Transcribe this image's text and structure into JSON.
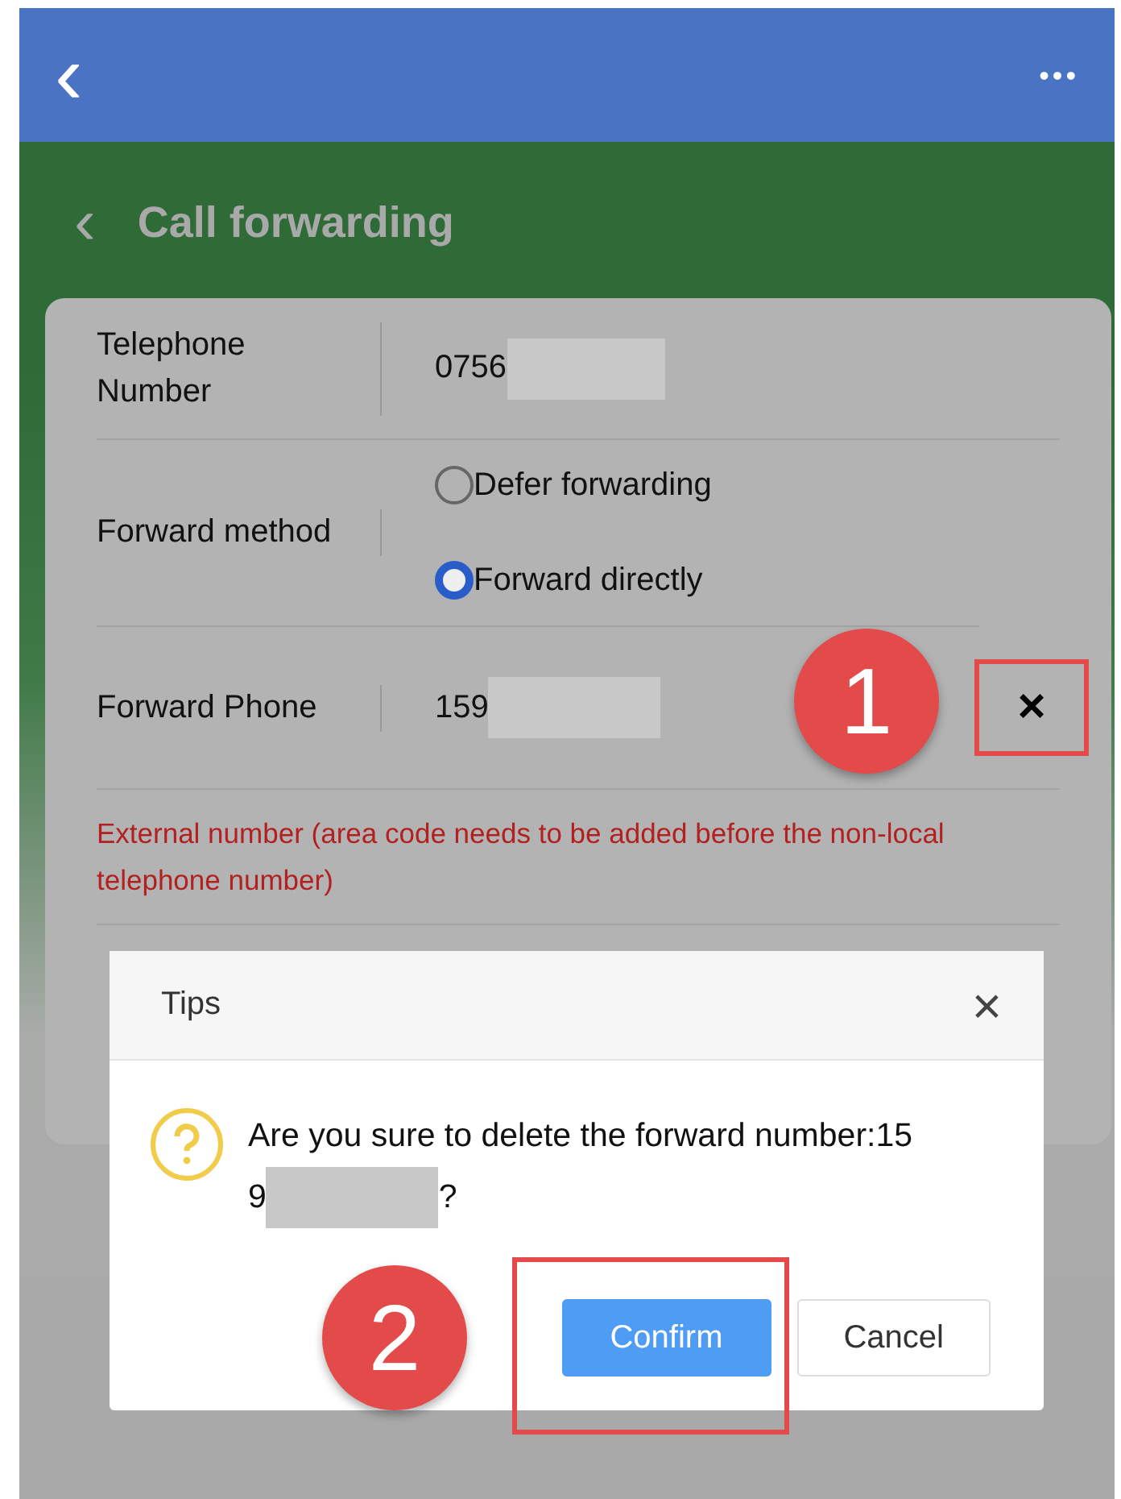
{
  "top_bar": {
    "back": "‹",
    "more": "•••"
  },
  "page": {
    "title": "Call forwarding"
  },
  "form": {
    "telephone": {
      "label": "Telephone Number",
      "value": "0756"
    },
    "method": {
      "label": "Forward method",
      "options": [
        {
          "label": "Defer forwarding",
          "selected": false
        },
        {
          "label": "Forward directly",
          "selected": true
        }
      ]
    },
    "forward_phone": {
      "label": "Forward Phone",
      "value": "159",
      "delete": "×"
    },
    "hint": "External number (area code needs to be added before the non-local telephone number)"
  },
  "dialog": {
    "title": "Tips",
    "close": "×",
    "message": "Are you sure to delete the forward number:15",
    "message_continued": "9",
    "message_end": "?",
    "buttons": [
      {
        "label": "Confirm",
        "kind": "primary"
      },
      {
        "label": "Cancel",
        "kind": "default"
      }
    ]
  },
  "annotations": [
    {
      "label": "1"
    },
    {
      "label": "2"
    }
  ]
}
